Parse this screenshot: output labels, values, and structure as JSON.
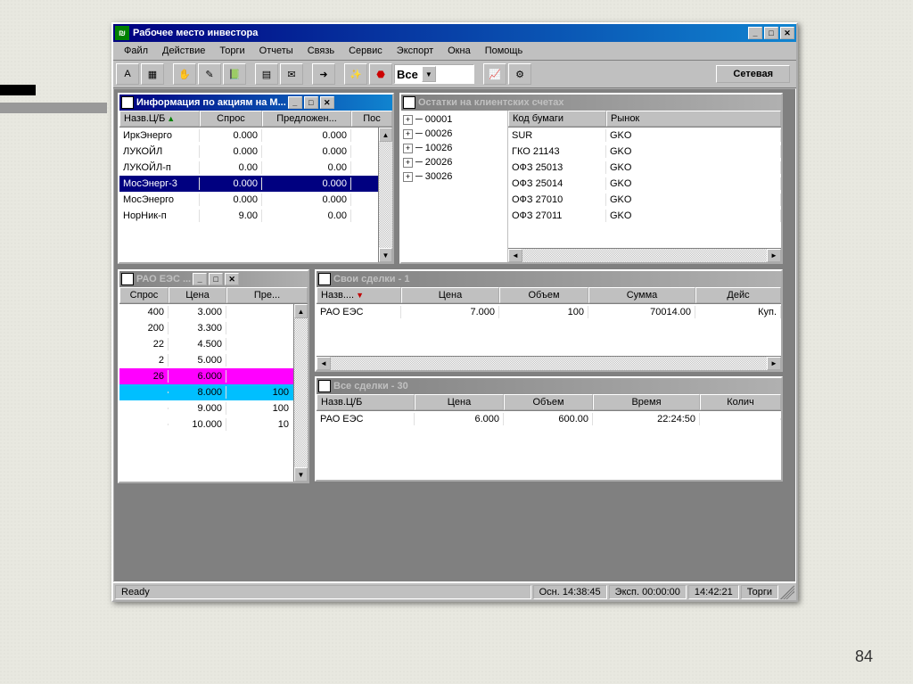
{
  "page_number": "84",
  "app": {
    "title": "Рабочее место инвестора",
    "menu": [
      "Файл",
      "Действие",
      "Торги",
      "Отчеты",
      "Связь",
      "Сервис",
      "Экспорт",
      "Окна",
      "Помощь"
    ],
    "combo_value": "Все",
    "net_label": "Сетевая"
  },
  "infoPanel": {
    "title": "Информация по акциям на М...",
    "cols": [
      "Назв.Ц/Б",
      "Спрос",
      "Предложен...",
      "Пос"
    ],
    "rows": [
      {
        "name": "ИркЭнерго",
        "bid": "0.000",
        "ask": "0.000"
      },
      {
        "name": "ЛУКОЙЛ",
        "bid": "0.000",
        "ask": "0.000"
      },
      {
        "name": "ЛУКОЙЛ-п",
        "bid": "0.00",
        "ask": "0.00"
      },
      {
        "name": "МосЭнерг-3",
        "bid": "0.000",
        "ask": "0.000",
        "sel": true
      },
      {
        "name": "МосЭнерго",
        "bid": "0.000",
        "ask": "0.000"
      },
      {
        "name": "НорНик-п",
        "bid": "9.00",
        "ask": "0.00"
      }
    ]
  },
  "balancesPanel": {
    "title": "Остатки на клиентских счетах",
    "tree": [
      "00001",
      "00026",
      "10026",
      "20026",
      "30026"
    ],
    "cols": [
      "Код бумаги",
      "Рынок"
    ],
    "rows": [
      {
        "code": "SUR",
        "market": "GKO"
      },
      {
        "code": "ГКО 21143",
        "market": "GKO"
      },
      {
        "code": "ОФЗ 25013",
        "market": "GKO"
      },
      {
        "code": "ОФЗ 25014",
        "market": "GKO"
      },
      {
        "code": "ОФЗ 27010",
        "market": "GKO"
      },
      {
        "code": "ОФЗ 27011",
        "market": "GKO"
      }
    ]
  },
  "raoPanel": {
    "title": "РАО ЕЭС    ...",
    "cols": [
      "Спрос",
      "Цена",
      "Пре..."
    ],
    "rows": [
      {
        "bid": "400",
        "price": "3.000",
        "ask": ""
      },
      {
        "bid": "200",
        "price": "3.300",
        "ask": ""
      },
      {
        "bid": "22",
        "price": "4.500",
        "ask": ""
      },
      {
        "bid": "2",
        "price": "5.000",
        "ask": ""
      },
      {
        "bid": "26",
        "price": "6.000",
        "ask": "",
        "cls": "magenta"
      },
      {
        "bid": "",
        "price": "8.000",
        "ask": "100",
        "cls": "cyan"
      },
      {
        "bid": "",
        "price": "9.000",
        "ask": "100"
      },
      {
        "bid": "",
        "price": "10.000",
        "ask": "10"
      }
    ]
  },
  "ownDealsPanel": {
    "title": "Свои сделки - 1",
    "cols": [
      "Назв....",
      "Цена",
      "Объем",
      "Сумма",
      "Дейс"
    ],
    "rows": [
      {
        "name": "РАО ЕЭС",
        "price": "7.000",
        "vol": "100",
        "sum": "70014.00",
        "act": "Куп."
      }
    ]
  },
  "allDealsPanel": {
    "title": "Все сделки - 30",
    "cols": [
      "Назв.Ц/Б",
      "Цена",
      "Объем",
      "Время",
      "Колич"
    ],
    "rows": [
      {
        "name": "РАО ЕЭС",
        "price": "6.000",
        "vol": "600.00",
        "time": "22:24:50",
        "qty": ""
      }
    ]
  },
  "status": {
    "ready": "Ready",
    "osn": "Осн. 14:38:45",
    "exp": "Эксп. 00:00:00",
    "clock": "14:42:21",
    "mode": "Торги"
  }
}
